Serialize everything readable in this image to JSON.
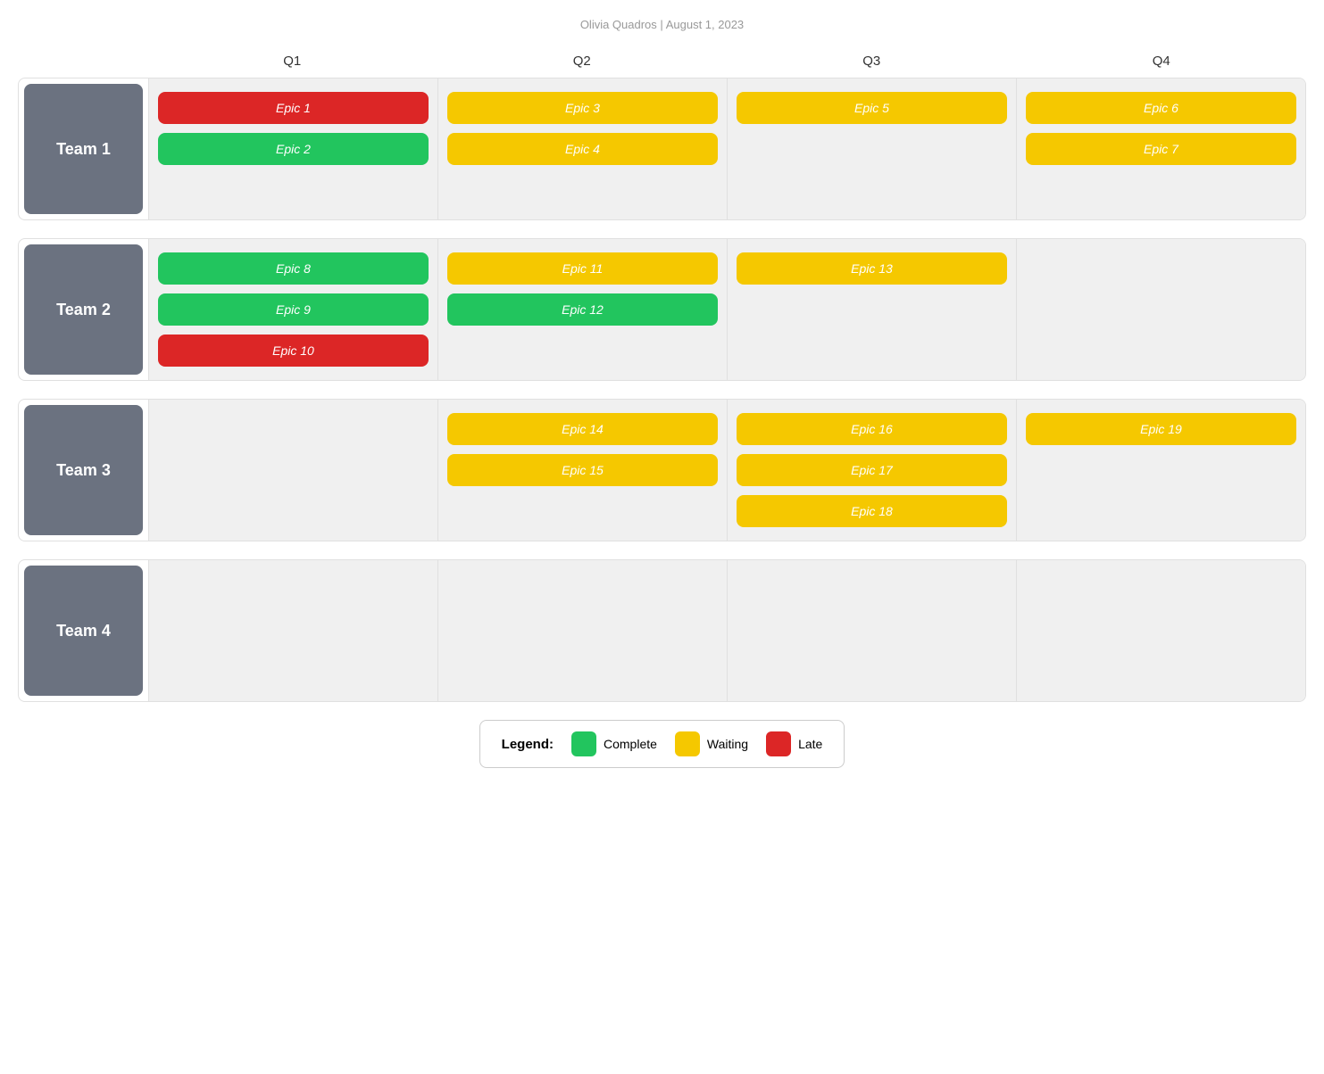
{
  "header": {
    "author": "Olivia Quadros",
    "date": "August 1, 2023",
    "separator": "|"
  },
  "quarters": [
    "Q1",
    "Q2",
    "Q3",
    "Q4"
  ],
  "teams": [
    {
      "name": "Team 1",
      "quarters": [
        [
          {
            "label": "Epic 1",
            "status": "late"
          },
          {
            "label": "Epic 2",
            "status": "complete"
          }
        ],
        [
          {
            "label": "Epic 3",
            "status": "waiting"
          },
          {
            "label": "Epic 4",
            "status": "waiting"
          }
        ],
        [
          {
            "label": "Epic 5",
            "status": "waiting"
          }
        ],
        [
          {
            "label": "Epic 6",
            "status": "waiting"
          },
          {
            "label": "Epic 7",
            "status": "waiting"
          }
        ]
      ]
    },
    {
      "name": "Team 2",
      "quarters": [
        [
          {
            "label": "Epic 8",
            "status": "complete"
          },
          {
            "label": "Epic 9",
            "status": "complete"
          },
          {
            "label": "Epic 10",
            "status": "late"
          }
        ],
        [
          {
            "label": "Epic 11",
            "status": "waiting"
          },
          {
            "label": "Epic 12",
            "status": "complete"
          }
        ],
        [
          {
            "label": "Epic 13",
            "status": "waiting"
          }
        ],
        []
      ]
    },
    {
      "name": "Team 3",
      "quarters": [
        [],
        [
          {
            "label": "Epic 14",
            "status": "waiting"
          },
          {
            "label": "Epic 15",
            "status": "waiting"
          }
        ],
        [
          {
            "label": "Epic 16",
            "status": "waiting"
          },
          {
            "label": "Epic 17",
            "status": "waiting"
          },
          {
            "label": "Epic 18",
            "status": "waiting"
          }
        ],
        [
          {
            "label": "Epic 19",
            "status": "waiting"
          }
        ]
      ]
    },
    {
      "name": "Team 4",
      "quarters": [
        [],
        [],
        [],
        []
      ]
    }
  ],
  "legend": {
    "title": "Legend:",
    "items": [
      {
        "label": "Complete",
        "status": "complete"
      },
      {
        "label": "Waiting",
        "status": "waiting"
      },
      {
        "label": "Late",
        "status": "late"
      }
    ]
  }
}
